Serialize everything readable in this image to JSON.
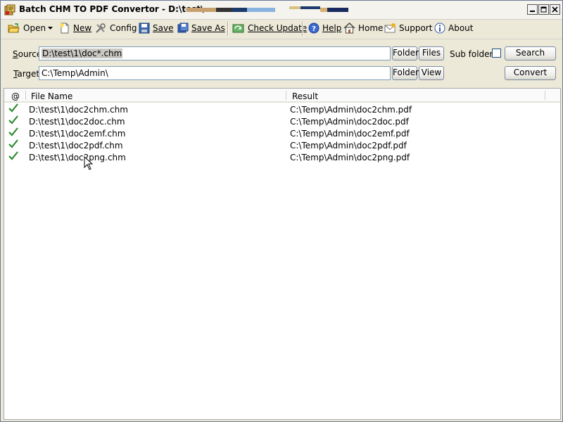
{
  "window": {
    "title": "Batch CHM TO PDF Convertor - D:\\test\\"
  },
  "toolbar": {
    "open": "Open",
    "new": "New",
    "config": "Config",
    "save": "Save",
    "save_as": "Save As",
    "check_update": "Check Update",
    "help": "Help",
    "home": "Home",
    "support": "Support",
    "about": "About"
  },
  "form": {
    "source_label": "Source",
    "source_value": "D:\\test\\1\\doc*.chm",
    "target_label": "Target",
    "target_value": "C:\\Temp\\Admin\\",
    "folder_label": "Folder",
    "files_label": "Files",
    "view_label": "View",
    "subfolders_label": "Sub folders",
    "subfolders_checked": false,
    "search_label": "Search",
    "convert_label": "Convert"
  },
  "list": {
    "columns": [
      "@",
      "File Name",
      "Result"
    ],
    "rows": [
      {
        "status": "ok",
        "file": "D:\\test\\1\\doc2chm.chm",
        "result": "C:\\Temp\\Admin\\doc2chm.pdf"
      },
      {
        "status": "ok",
        "file": "D:\\test\\1\\doc2doc.chm",
        "result": "C:\\Temp\\Admin\\doc2doc.pdf"
      },
      {
        "status": "ok",
        "file": "D:\\test\\1\\doc2emf.chm",
        "result": "C:\\Temp\\Admin\\doc2emf.pdf"
      },
      {
        "status": "ok",
        "file": "D:\\test\\1\\doc2pdf.chm",
        "result": "C:\\Temp\\Admin\\doc2pdf.pdf"
      },
      {
        "status": "ok",
        "file": "D:\\test\\1\\doc2png.chm",
        "result": "C:\\Temp\\Admin\\doc2png.pdf"
      }
    ]
  },
  "colors": {
    "check_green": "#2e8b2e",
    "field_border": "#7f9db9",
    "window_bg": "#ece9d8"
  }
}
